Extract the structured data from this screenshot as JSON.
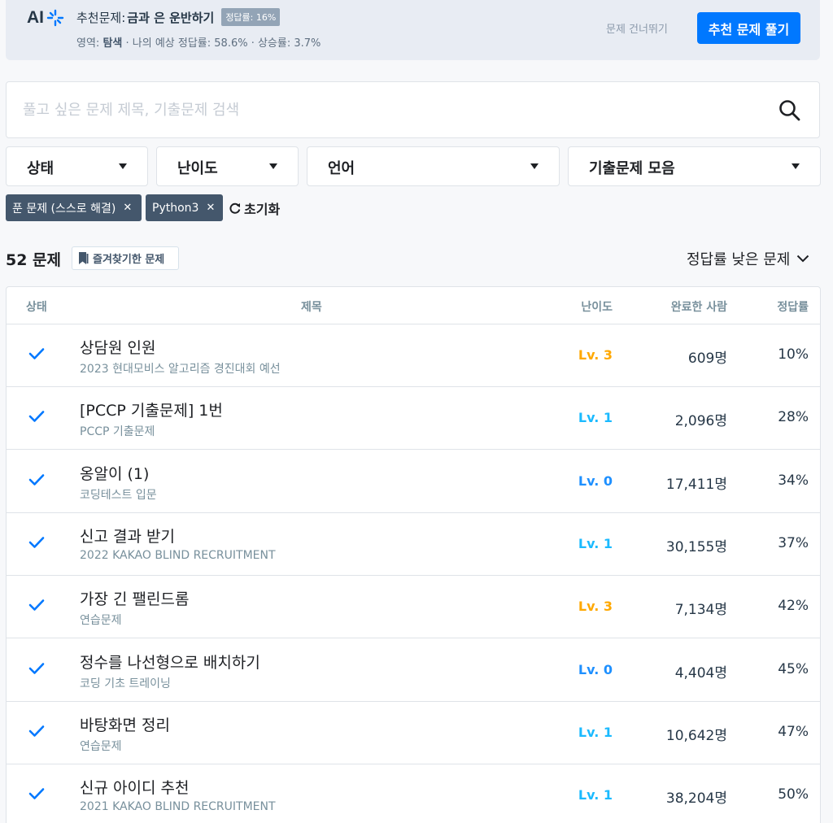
{
  "banner": {
    "prefix": "추천문제:",
    "problem_title": "금과 은 운반하기",
    "badge": "정답률: 16%",
    "meta_area_label": "영역:",
    "meta_area_value": "탐색",
    "meta_rest": "· 나의 예상 정답률: 58.6% · 상승률: 3.7%",
    "skip_label": "문제 건너뛰기",
    "solve_label": "추천 문제 풀기",
    "accent": "#0078ff"
  },
  "search": {
    "placeholder": "풀고 싶은 문제 제목, 기출문제 검색",
    "value": "",
    "icon": "search-icon"
  },
  "filters": [
    {
      "label": "상태"
    },
    {
      "label": "난이도"
    },
    {
      "label": "언어"
    },
    {
      "label": "기출문제 모음"
    }
  ],
  "active_tags": [
    {
      "label": "푼 문제 (스스로 해결)"
    },
    {
      "label": "Python3"
    }
  ],
  "reset_label": "초기화",
  "count_label": "52 문제",
  "bookmark_label": "즐겨찾기한 문제",
  "sort_label": "정답률 낮은 문제",
  "table": {
    "headers": {
      "status": "상태",
      "title": "제목",
      "level": "난이도",
      "completed": "완료한 사람",
      "rate": "정답률"
    },
    "rows": [
      {
        "title": "상담원 인원",
        "sub": "2023 현대모비스 알고리즘 경진대회 예선",
        "level": "Lv. 3",
        "level_color": "#ffa800",
        "completed": "609명",
        "rate": "10%"
      },
      {
        "title": "[PCCP 기출문제] 1번",
        "sub": "PCCP 기출문제",
        "level": "Lv. 1",
        "level_color": "#1bbaff",
        "completed": "2,096명",
        "rate": "28%"
      },
      {
        "title": "옹알이 (1)",
        "sub": "코딩테스트 입문",
        "level": "Lv. 0",
        "level_color": "#1e90ff",
        "completed": "17,411명",
        "rate": "34%"
      },
      {
        "title": "신고 결과 받기",
        "sub": "2022 KAKAO BLIND RECRUITMENT",
        "level": "Lv. 1",
        "level_color": "#1bbaff",
        "completed": "30,155명",
        "rate": "37%"
      },
      {
        "title": "가장 긴 팰린드롬",
        "sub": "연습문제",
        "level": "Lv. 3",
        "level_color": "#ffa800",
        "completed": "7,134명",
        "rate": "42%"
      },
      {
        "title": "정수를 나선형으로 배치하기",
        "sub": "코딩 기초 트레이닝",
        "level": "Lv. 0",
        "level_color": "#1e90ff",
        "completed": "4,404명",
        "rate": "45%"
      },
      {
        "title": "바탕화면 정리",
        "sub": "연습문제",
        "level": "Lv. 1",
        "level_color": "#1bbaff",
        "completed": "10,642명",
        "rate": "47%"
      },
      {
        "title": "신규 아이디 추천",
        "sub": "2021 KAKAO BLIND RECRUITMENT",
        "level": "Lv. 1",
        "level_color": "#1bbaff",
        "completed": "38,204명",
        "rate": "50%"
      }
    ]
  }
}
